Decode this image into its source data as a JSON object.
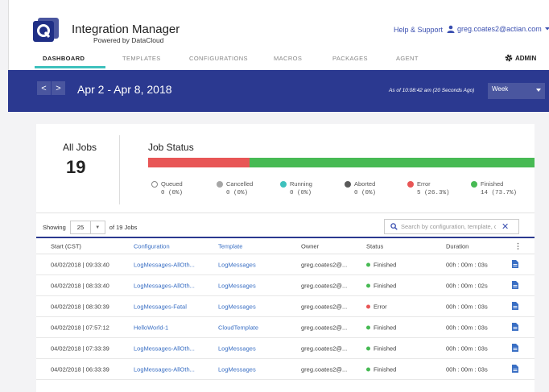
{
  "header": {
    "app_title": "Integration Manager",
    "app_subtitle": "Powered by DataCloud",
    "help_link": "Help & Support",
    "user_email": "greg.coates2@actian.com"
  },
  "nav": {
    "tabs": [
      {
        "label": "DASHBOARD",
        "active": true
      },
      {
        "label": "TEMPLATES",
        "active": false
      },
      {
        "label": "CONFIGURATIONS",
        "active": false
      },
      {
        "label": "MACROS",
        "active": false
      },
      {
        "label": "PACKAGES",
        "active": false
      },
      {
        "label": "AGENT",
        "active": false
      }
    ],
    "admin_label": "ADMIN"
  },
  "datebar": {
    "prev": "<",
    "next": ">",
    "range": "Apr 2 - Apr 8, 2018",
    "as_of": "As of 10:08:42 am (20 Seconds Ago)",
    "period": "Week"
  },
  "summary": {
    "all_jobs_label": "All Jobs",
    "all_jobs_count": "19",
    "job_status_label": "Job Status",
    "status_bar": [
      {
        "name": "Error",
        "fraction": 0.263,
        "color": "#e85656"
      },
      {
        "name": "Finished",
        "fraction": 0.737,
        "color": "#47ba54"
      }
    ],
    "legend": [
      {
        "name": "Queued",
        "value": "0 (0%)",
        "color": "#ffffff"
      },
      {
        "name": "Cancelled",
        "value": "0 (0%)",
        "color": "#a6a6a6"
      },
      {
        "name": "Running",
        "value": "0 (0%)",
        "color": "#3ec1bd"
      },
      {
        "name": "Aborted",
        "value": "0 (0%)",
        "color": "#5a5a5a"
      },
      {
        "name": "Error",
        "value": "5 (26.3%)",
        "color": "#e85656"
      },
      {
        "name": "Finished",
        "value": "14 (73.7%)",
        "color": "#47ba54"
      }
    ]
  },
  "list": {
    "showing_label": "Showing",
    "page_size": "25",
    "total_label": "of 19 Jobs",
    "search_placeholder": "Search by configuration, template, o"
  },
  "table": {
    "columns": [
      "Start (CST)",
      "Configuration",
      "Template",
      "Owner",
      "Status",
      "Duration"
    ],
    "rows": [
      {
        "start": "04/02/2018 | 09:33:40",
        "config": "LogMessages-AllOth...",
        "template": "LogMessages",
        "owner": "greg.coates2@...",
        "status": "Finished",
        "duration": "00h : 00m : 03s"
      },
      {
        "start": "04/02/2018 | 08:33:40",
        "config": "LogMessages-AllOth...",
        "template": "LogMessages",
        "owner": "greg.coates2@...",
        "status": "Finished",
        "duration": "00h : 00m : 02s"
      },
      {
        "start": "04/02/2018 | 08:30:39",
        "config": "LogMessages-Fatal",
        "template": "LogMessages",
        "owner": "greg.coates2@...",
        "status": "Error",
        "duration": "00h : 00m : 03s"
      },
      {
        "start": "04/02/2018 | 07:57:12",
        "config": "HelloWorld-1",
        "template": "CloudTemplate",
        "owner": "greg.coates2@...",
        "status": "Finished",
        "duration": "00h : 00m : 03s"
      },
      {
        "start": "04/02/2018 | 07:33:39",
        "config": "LogMessages-AllOth...",
        "template": "LogMessages",
        "owner": "greg.coates2@...",
        "status": "Finished",
        "duration": "00h : 00m : 03s"
      },
      {
        "start": "04/02/2018 | 06:33:39",
        "config": "LogMessages-AllOth...",
        "template": "LogMessages",
        "owner": "greg.coates2@...",
        "status": "Finished",
        "duration": "00h : 00m : 03s"
      }
    ]
  },
  "colors": {
    "brand": "#2b3990",
    "accent": "#3ec1bd",
    "link": "#3a6fc4",
    "error": "#e85656",
    "finished": "#47ba54"
  }
}
